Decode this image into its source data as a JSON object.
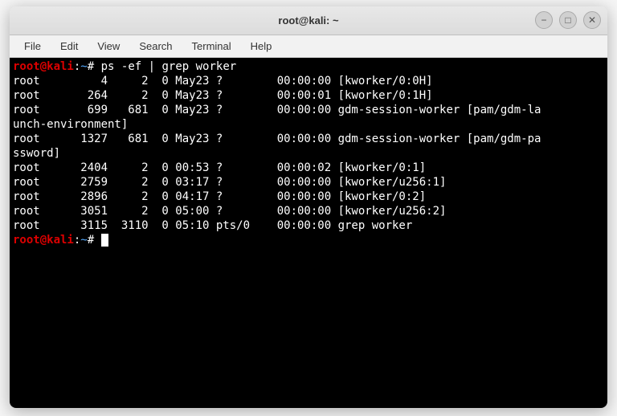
{
  "window": {
    "title": "root@kali: ~"
  },
  "menu": {
    "file": "File",
    "edit": "Edit",
    "view": "View",
    "search": "Search",
    "terminal": "Terminal",
    "help": "Help"
  },
  "prompt": {
    "user_host": "root@kali",
    "colon": ":",
    "path": "~",
    "hash": "#"
  },
  "command": "ps -ef | grep worker",
  "output": [
    "root         4     2  0 May23 ?        00:00:00 [kworker/0:0H]",
    "root       264     2  0 May23 ?        00:00:01 [kworker/0:1H]",
    "root       699   681  0 May23 ?        00:00:00 gdm-session-worker [pam/gdm-la",
    "unch-environment]",
    "root      1327   681  0 May23 ?        00:00:00 gdm-session-worker [pam/gdm-pa",
    "ssword]",
    "root      2404     2  0 00:53 ?        00:00:02 [kworker/0:1]",
    "root      2759     2  0 03:17 ?        00:00:00 [kworker/u256:1]",
    "root      2896     2  0 04:17 ?        00:00:00 [kworker/0:2]",
    "root      3051     2  0 05:00 ?        00:00:00 [kworker/u256:2]",
    "root      3115  3110  0 05:10 pts/0    00:00:00 grep worker"
  ],
  "win_controls": {
    "minimize": "−",
    "maximize": "□",
    "close": "✕"
  }
}
